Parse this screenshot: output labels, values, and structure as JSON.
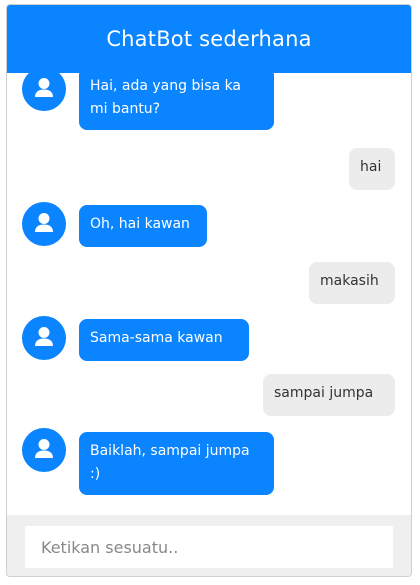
{
  "header": {
    "title": "ChatBot sederhana"
  },
  "messages": [
    {
      "sender": "bot",
      "text": "Hai, ada yang bisa ka\nmi bantu?"
    },
    {
      "sender": "user",
      "text": "hai"
    },
    {
      "sender": "bot",
      "text": "Oh, hai kawan"
    },
    {
      "sender": "user",
      "text": "makasih"
    },
    {
      "sender": "bot",
      "text": "Sama-sama kawan"
    },
    {
      "sender": "user",
      "text": "sampai jumpa"
    },
    {
      "sender": "bot",
      "text": "Baiklah, sampai jumpa\n:)"
    }
  ],
  "input": {
    "placeholder": "Ketikan sesuatu..",
    "value": ""
  },
  "colors": {
    "accent": "#0a84ff",
    "user_bubble": "#ececec",
    "footer_bg": "#efefef"
  },
  "icons": {
    "avatar": "user-icon"
  }
}
